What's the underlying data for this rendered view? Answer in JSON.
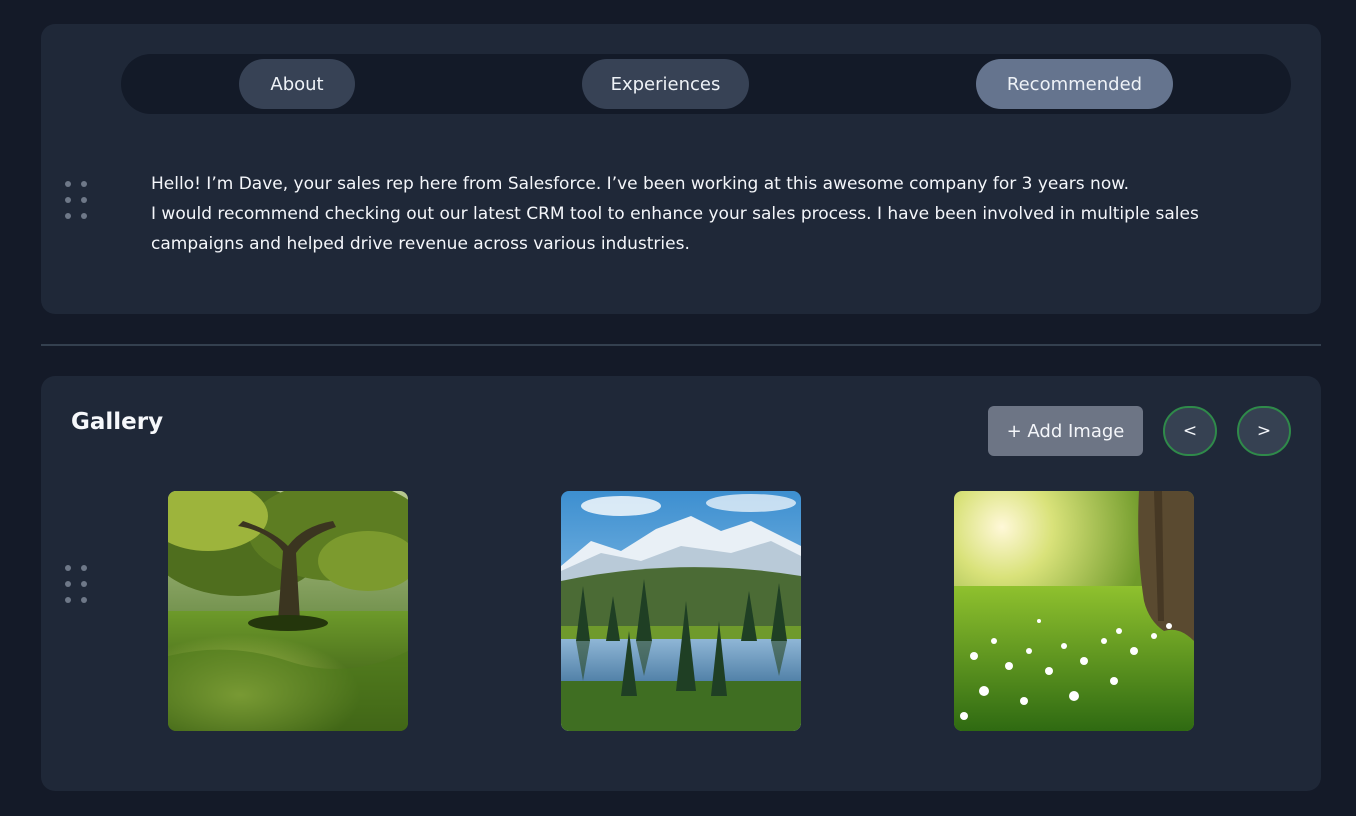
{
  "tabs": {
    "about": "About",
    "experiences": "Experiences",
    "recommended": "Recommended",
    "active": "recommended"
  },
  "bio": {
    "line1": "Hello! I’m Dave, your sales rep here from Salesforce. I’ve been working at this awesome company for 3 years now.",
    "line2": "I would recommend checking out our latest CRM tool to enhance your sales process. I have been involved in multiple sales campaigns and helped drive revenue across various industries."
  },
  "gallery": {
    "title": "Gallery",
    "add_label": "+ Add Image",
    "prev_label": "<",
    "next_label": ">",
    "images": [
      {
        "subject": "tree in sunlit meadow"
      },
      {
        "subject": "snowy mountains over forest lake"
      },
      {
        "subject": "tree trunk with white flowers in grass"
      }
    ]
  },
  "colors": {
    "background": "#141a28",
    "card": "#1f2838",
    "tab": "#374255",
    "tab_active": "#65748e",
    "add_button": "#6d7585",
    "nav_border": "#2f8a4a"
  }
}
